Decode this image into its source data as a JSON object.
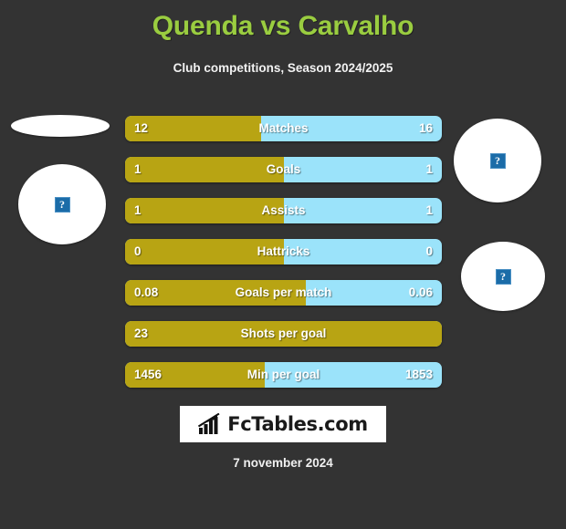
{
  "header": {
    "title": "Quenda vs Carvalho",
    "subtitle": "Club competitions, Season 2024/2025"
  },
  "colors": {
    "background": "#333333",
    "title": "#9ACD40",
    "left_bar": "#B8A413",
    "right_bar": "#9BE3FA",
    "text": "#ffffff"
  },
  "media": {
    "left_club_logo": "broken-image-icon",
    "left_player_photo": "broken-image-icon",
    "right_player_photo": "broken-image-icon",
    "right_club_logo": "broken-image-icon",
    "broken_glyph": "?"
  },
  "logo": {
    "text": "FcTables.com",
    "icon": "bar-chart-icon"
  },
  "footer": {
    "date": "7 november 2024"
  },
  "chart_data": {
    "type": "bar",
    "title": "Quenda vs Carvalho",
    "subtitle": "Club competitions, Season 2024/2025",
    "orientation": "horizontal-diverging",
    "xlabel": "",
    "ylabel": "",
    "grid": false,
    "legend_position": "none",
    "series": [
      {
        "name": "Quenda",
        "color": "#B8A413",
        "side": "left"
      },
      {
        "name": "Carvalho",
        "color": "#9BE3FA",
        "side": "right"
      }
    ],
    "categories": [
      "Matches",
      "Goals",
      "Assists",
      "Hattricks",
      "Goals per match",
      "Shots per goal",
      "Min per goal"
    ],
    "rows": [
      {
        "label": "Matches",
        "left": "12",
        "right": "16",
        "left_pct": 43
      },
      {
        "label": "Goals",
        "left": "1",
        "right": "1",
        "left_pct": 50
      },
      {
        "label": "Assists",
        "left": "1",
        "right": "1",
        "left_pct": 50
      },
      {
        "label": "Hattricks",
        "left": "0",
        "right": "0",
        "left_pct": 50
      },
      {
        "label": "Goals per match",
        "left": "0.08",
        "right": "0.06",
        "left_pct": 57
      },
      {
        "label": "Shots per goal",
        "left": "23",
        "right": "",
        "left_pct": 100
      },
      {
        "label": "Min per goal",
        "left": "1456",
        "right": "1853",
        "left_pct": 44
      }
    ]
  }
}
